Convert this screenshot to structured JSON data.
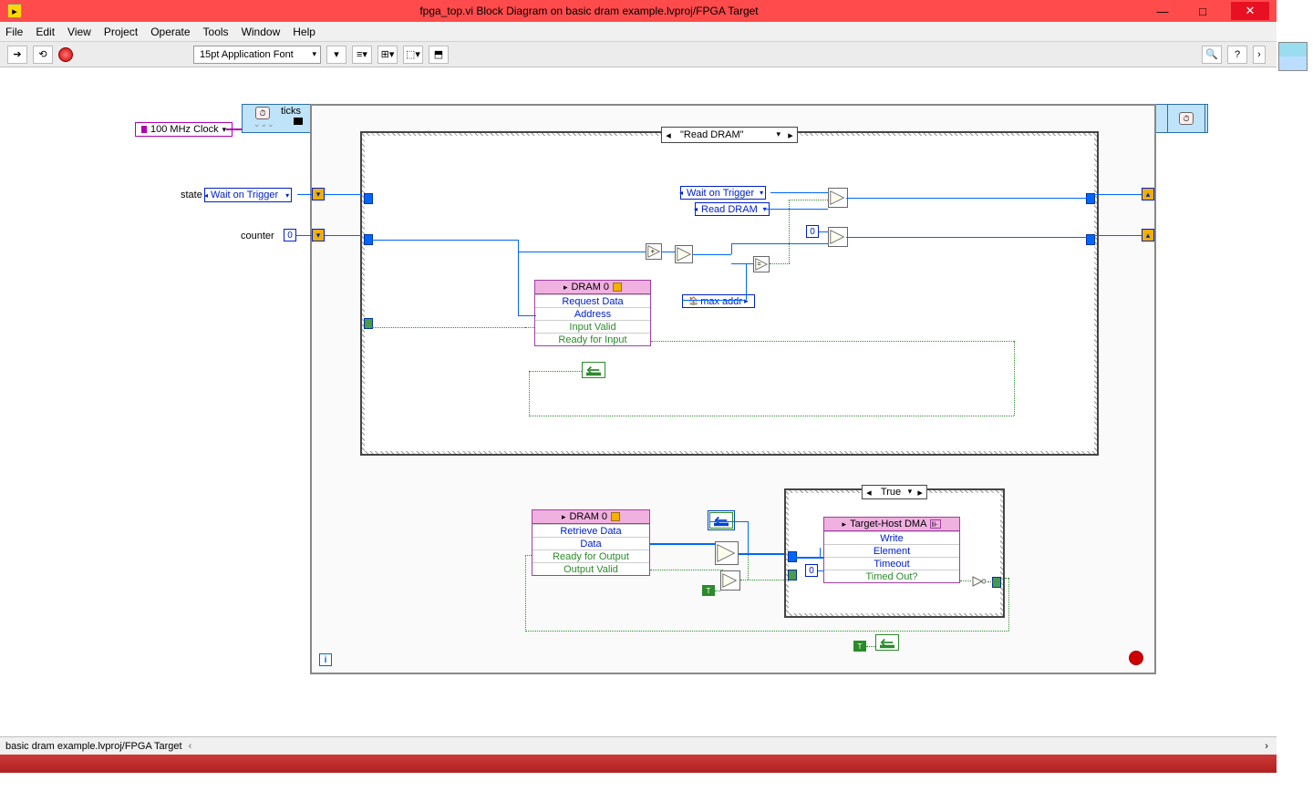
{
  "titlebar": {
    "title": "fpga_top.vi Block Diagram on basic dram example.lvproj/FPGA Target"
  },
  "menu": {
    "file": "File",
    "edit": "Edit",
    "view": "View",
    "project": "Project",
    "operate": "Operate",
    "tools": "Tools",
    "window": "Window",
    "help": "Help"
  },
  "toolbar": {
    "font": "15pt Application Font"
  },
  "diagram": {
    "clock": "100 MHz Clock",
    "ticks": "ticks",
    "state_label": "state",
    "state_enum": "Wait on Trigger",
    "counter_label": "counter",
    "counter_val": "0",
    "case_label": "\"Read DRAM\"",
    "wait_enum": "Wait on Trigger",
    "read_enum": "Read DRAM",
    "zero_const": "0",
    "max_addr": "max addr",
    "dram0": {
      "title": "DRAM 0",
      "r1": "Request Data",
      "r2": "Address",
      "r3": "Input Valid",
      "r4": "Ready for Input"
    },
    "dram0b": {
      "title": "DRAM 0",
      "r1": "Retrieve Data",
      "r2": "Data",
      "r3": "Ready for Output",
      "r4": "Output Valid"
    },
    "true_case": "True",
    "dma_zero": "0",
    "dma": {
      "title": "Target-Host DMA",
      "r1": "Write",
      "r2": "Element",
      "r3": "Timeout",
      "r4": "Timed Out?"
    },
    "iter": "i",
    "bool_t": "T"
  },
  "status": {
    "path": "basic dram example.lvproj/FPGA Target"
  }
}
